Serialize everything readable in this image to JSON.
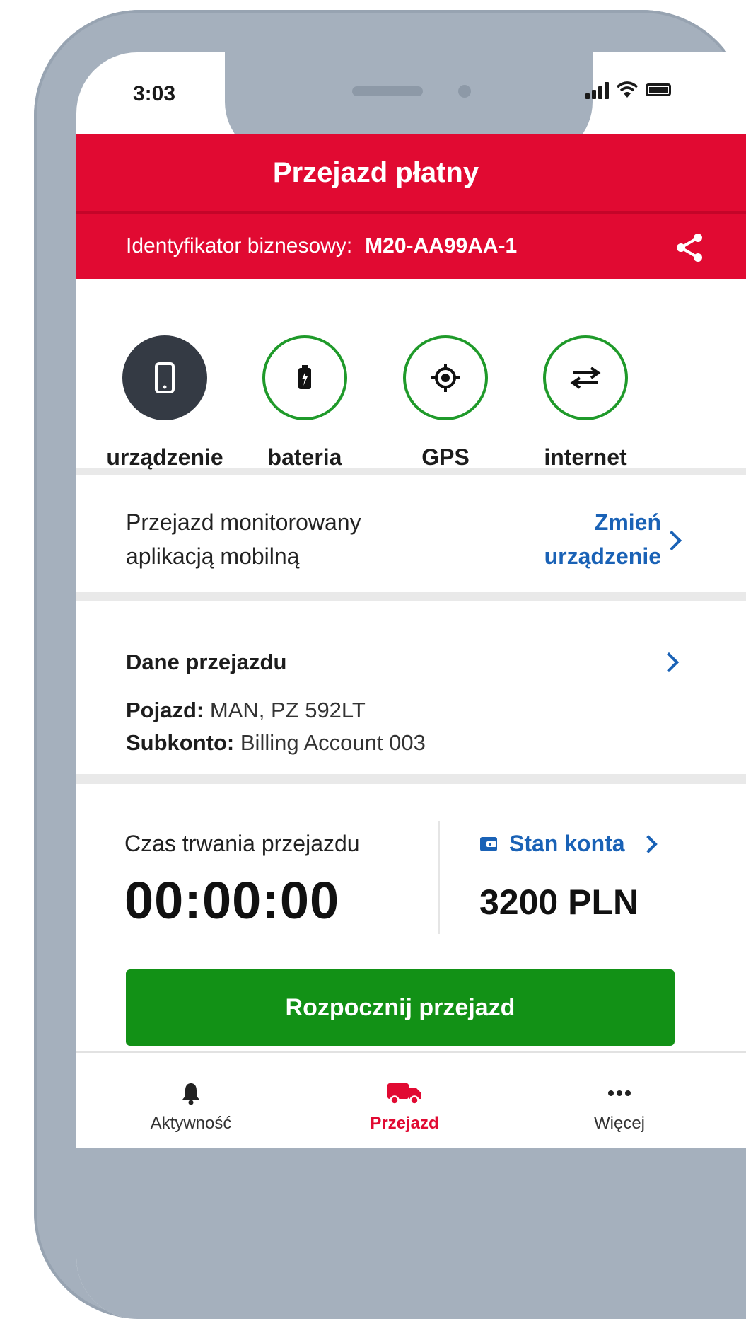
{
  "status_bar": {
    "time": "3:03"
  },
  "header": {
    "title": "Przejazd płatny",
    "business_id_label": "Identyfikator biznesowy:",
    "business_id_value": "M20-AA99AA-1"
  },
  "indicators": [
    {
      "label": "urządzenie",
      "icon": "smartphone-icon",
      "state": "dark"
    },
    {
      "label": "bateria",
      "icon": "battery-charging-icon",
      "state": "ok"
    },
    {
      "label": "GPS",
      "icon": "location-target-icon",
      "state": "ok"
    },
    {
      "label": "internet",
      "icon": "transfer-arrows-icon",
      "state": "ok"
    }
  ],
  "monitoring": {
    "text_line1": "Przejazd monitorowany",
    "text_line2": "aplikacją mobilną",
    "change_line1": "Zmień",
    "change_line2": "urządzenie"
  },
  "trip": {
    "title": "Dane przejazdu",
    "vehicle_label": "Pojazd:",
    "vehicle_value": "MAN, PZ 592LT",
    "subaccount_label": "Subkonto:",
    "subaccount_value": "Billing Account 003"
  },
  "duration": {
    "label": "Czas trwania przejazdu",
    "value": "00:00:00"
  },
  "account": {
    "label": "Stan konta",
    "value": "3200 PLN"
  },
  "start_button": "Rozpocznij przejazd",
  "nav": [
    {
      "label": "Aktywność",
      "icon": "bell-icon",
      "active": false
    },
    {
      "label": "Przejazd",
      "icon": "truck-icon",
      "active": true
    },
    {
      "label": "Więcej",
      "icon": "more-dots-icon",
      "active": false
    }
  ],
  "colors": {
    "brand_red": "#e10a32",
    "ok_green": "#1f9a2a",
    "link_blue": "#1a62b6",
    "button_green": "#129116"
  }
}
